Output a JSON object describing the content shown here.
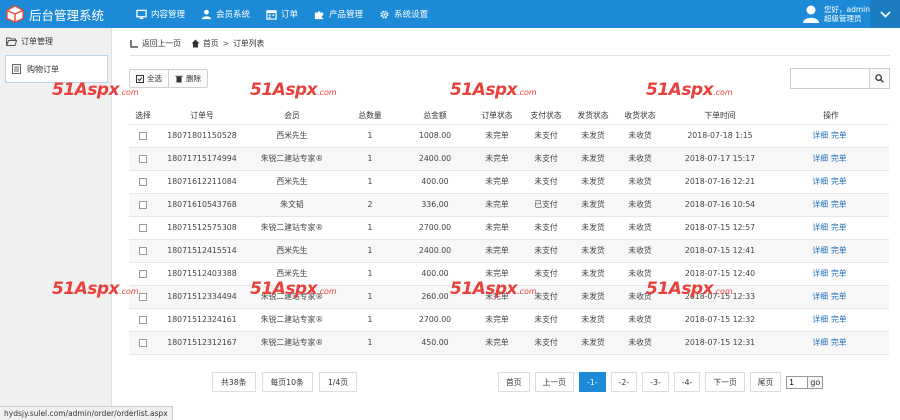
{
  "header": {
    "brand_title": "后台管理系统",
    "nav": [
      {
        "label": "内容管理",
        "icon": "monitor-icon"
      },
      {
        "label": "会员系统",
        "icon": "user-icon"
      },
      {
        "label": "订单",
        "icon": "calendar-icon"
      },
      {
        "label": "产品管理",
        "icon": "puzzle-icon"
      },
      {
        "label": "系统设置",
        "icon": "gear-icon"
      }
    ],
    "greeting": "您好，admin",
    "role": "超级管理员",
    "colors": {
      "bar": "#1c8ad6",
      "toggle": "#1b7cc1"
    }
  },
  "sidebar": {
    "group_label": "订单管理",
    "items": [
      {
        "label": "购物订单",
        "active": true
      }
    ]
  },
  "breadcrumb": {
    "back": "返回上一页",
    "home": "首页",
    "current": "订单列表"
  },
  "toolbar": {
    "select_all": "全选",
    "delete": "删除"
  },
  "search": {
    "value": "",
    "placeholder": ""
  },
  "table": {
    "headers": [
      "选择",
      "订单号",
      "会员",
      "总数量",
      "总金额",
      "订单状态",
      "支付状态",
      "发货状态",
      "收货状态",
      "下单时间",
      "操作"
    ],
    "rows": [
      {
        "no": "18071801150528",
        "member": "西米先生",
        "qty": "1",
        "amount": "1008.00",
        "order": "未完单",
        "pay": "未支付",
        "ship": "未发货",
        "recv": "未收货",
        "time": "2018-07-18 1:15"
      },
      {
        "no": "18071715174994",
        "member": "朱锐二建站专家®",
        "qty": "1",
        "amount": "2400.00",
        "order": "未完单",
        "pay": "未支付",
        "ship": "未发货",
        "recv": "未收货",
        "time": "2018-07-17 15:17"
      },
      {
        "no": "18071612211084",
        "member": "西米先生",
        "qty": "1",
        "amount": "400.00",
        "order": "未完单",
        "pay": "未支付",
        "ship": "未发货",
        "recv": "未收货",
        "time": "2018-07-16 12:21"
      },
      {
        "no": "18071610543768",
        "member": "朱文韬",
        "qty": "2",
        "amount": "336.00",
        "order": "未完单",
        "pay": "已支付",
        "ship": "未发货",
        "recv": "未收货",
        "time": "2018-07-16 10:54"
      },
      {
        "no": "18071512575308",
        "member": "朱锐二建站专家®",
        "qty": "1",
        "amount": "2700.00",
        "order": "未完单",
        "pay": "未支付",
        "ship": "未发货",
        "recv": "未收货",
        "time": "2018-07-15 12:57"
      },
      {
        "no": "18071512415514",
        "member": "西米先生",
        "qty": "1",
        "amount": "2400.00",
        "order": "未完单",
        "pay": "未支付",
        "ship": "未发货",
        "recv": "未收货",
        "time": "2018-07-15 12:41"
      },
      {
        "no": "18071512403388",
        "member": "西米先生",
        "qty": "1",
        "amount": "400.00",
        "order": "未完单",
        "pay": "未支付",
        "ship": "未发货",
        "recv": "未收货",
        "time": "2018-07-15 12:40"
      },
      {
        "no": "18071512334494",
        "member": "朱锐二建站专家®",
        "qty": "1",
        "amount": "260.00",
        "order": "未完单",
        "pay": "未支付",
        "ship": "未发货",
        "recv": "未收货",
        "time": "2018-07-15 12:33"
      },
      {
        "no": "18071512324161",
        "member": "朱锐二建站专家®",
        "qty": "1",
        "amount": "2700.00",
        "order": "未完单",
        "pay": "未支付",
        "ship": "未发货",
        "recv": "未收货",
        "time": "2018-07-15 12:32"
      },
      {
        "no": "18071512312167",
        "member": "朱锐二建站专家®",
        "qty": "1",
        "amount": "450.00",
        "order": "未完单",
        "pay": "未支付",
        "ship": "未发货",
        "recv": "未收货",
        "time": "2018-07-15 12:31"
      }
    ],
    "action_detail": "详细",
    "action_complete": "完单"
  },
  "pager_info": {
    "total": "共38条",
    "per_page": "每页10条",
    "page_of": "1/4页"
  },
  "pager": {
    "first": "首页",
    "prev": "上一页",
    "pages": [
      "-1-",
      "-2-",
      "-3-",
      "-4-"
    ],
    "active_page": "-1-",
    "next": "下一页",
    "last": "尾页",
    "goto_value": "1",
    "go": "go"
  },
  "watermark": {
    "brand": "51Aspx",
    "domain": ".com"
  },
  "status_url": "hydsjy.sulel.com/admin/order/orderlist.aspx"
}
